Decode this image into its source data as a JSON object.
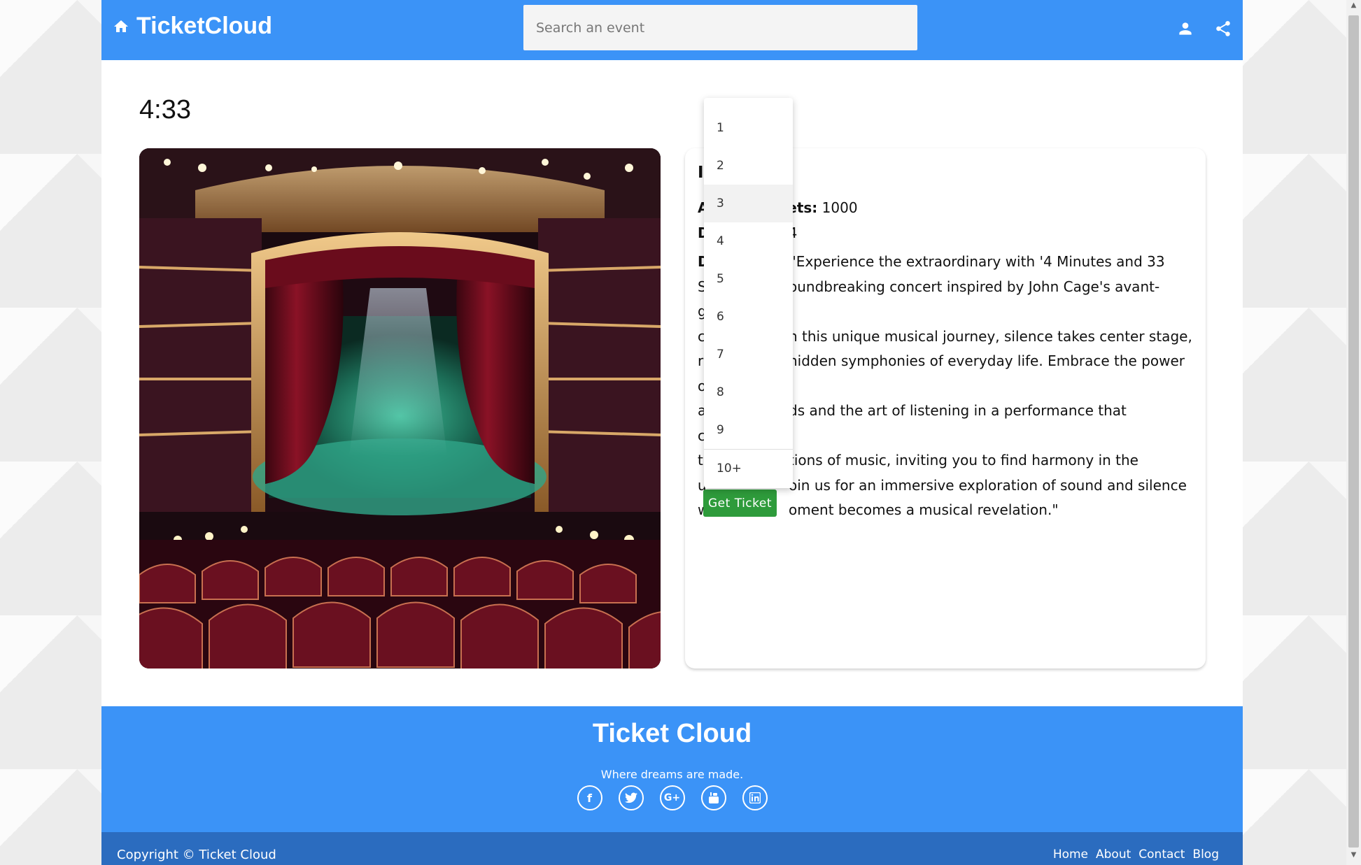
{
  "header": {
    "brand": "TicketCloud",
    "search_placeholder": "Search an event"
  },
  "event": {
    "title": "4:33",
    "info_heading_fragment": "I",
    "info_heading_end": ":",
    "available_label_fragment": "A",
    "available_label_end": "kets:",
    "available_value": "1000",
    "date_label_fragment": "D",
    "date_value_fragment": "4",
    "desc_label_fragment": "D",
    "description_lines": [
      "\"Experience the extraordinary with '4 Minutes and 33",
      "oundbreaking concert inspired by John Cage's avant-garde",
      "n this unique musical journey, silence takes center stage,",
      "hidden symphonies of everyday life. Embrace the power of",
      "ds and the art of listening in a performance that challenges",
      "tions of music, inviting you to find harmony in the",
      "oin us for an immersive exploration of sound and silence",
      "oment becomes a musical revelation.\""
    ],
    "description_line_starts": [
      "",
      "S",
      "c",
      "r",
      "a",
      "t",
      "u",
      "w"
    ],
    "get_ticket_label": "Get Ticket"
  },
  "quantity_dropdown": {
    "options": [
      "1",
      "2",
      "3",
      "4",
      "5",
      "6",
      "7",
      "8",
      "9",
      "10+"
    ],
    "highlighted": "3"
  },
  "footer": {
    "title": "Ticket Cloud",
    "tagline": "Where dreams are made.",
    "socials": [
      "facebook-icon",
      "twitter-icon",
      "google-plus-icon",
      "youtube-icon",
      "linkedin-icon"
    ],
    "copyright": "Copyright © Ticket Cloud",
    "links": [
      "Home",
      "About",
      "Contact",
      "Blog"
    ]
  },
  "colors": {
    "primary": "#3b93f7",
    "footer_bar": "#2b6cbf",
    "ticket_button": "#2e9b3b"
  }
}
